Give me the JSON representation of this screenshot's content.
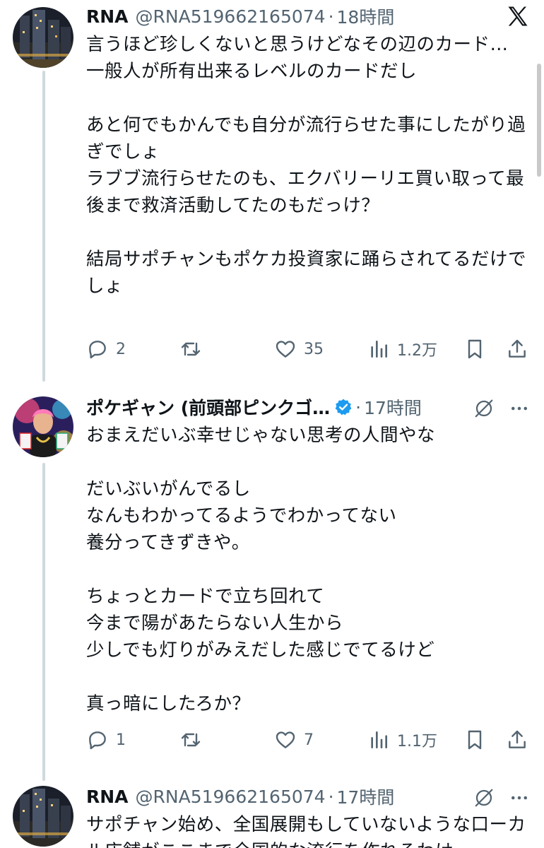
{
  "tweets": [
    {
      "name": "RNA",
      "handle": "@RNA519662165074",
      "separator": "·",
      "time": "18時間",
      "body": "言うほど珍しくないと思うけどなその辺のカード…\n一般人が所有出来るレベルのカードだし\n\nあと何でもかんでも自分が流行らせた事にしたがり過ぎでしょ\nラブブ流行らせたのも、エクバリーリエ買い取って最後まで救済活動してたのもだっけ？\n\n結局サポチャンもポケカ投資家に踊らされてるだけでしょ",
      "replies": "2",
      "retweets": "",
      "likes": "35",
      "views": "1.2万"
    },
    {
      "name": "ポケギャン (前頭部ピンクゴ…",
      "handle": "",
      "separator": "·",
      "time": "17時間",
      "body": "おまえだいぶ幸せじゃない思考の人間やな\n\nだいぶいがんでるし\nなんもわかってるようでわかってない\n養分ってきずきや。\n\nちょっとカードで立ち回れて\n今まで陽があたらない人生から\n少しでも灯りがみえだした感じでてるけど\n\n真っ暗にしたろか？",
      "replies": "1",
      "retweets": "",
      "likes": "7",
      "views": "1.1万"
    },
    {
      "name": "RNA",
      "handle": "@RNA519662165074",
      "separator": "·",
      "time": "17時間",
      "body": "サポチャン始め、全国展開もしていないような口ーカル店舗がここまで全国的な流行を作れるわけ"
    }
  ],
  "colors": {
    "text": "#0f1419",
    "secondary": "#536471",
    "verified": "#1d9bf0",
    "thread_line": "#cfd9de"
  },
  "icons": [
    "x-logo-icon",
    "grok-icon",
    "more-icon",
    "reply-icon",
    "retweet-icon",
    "like-icon",
    "views-icon",
    "bookmark-icon",
    "share-icon",
    "verified-icon"
  ]
}
